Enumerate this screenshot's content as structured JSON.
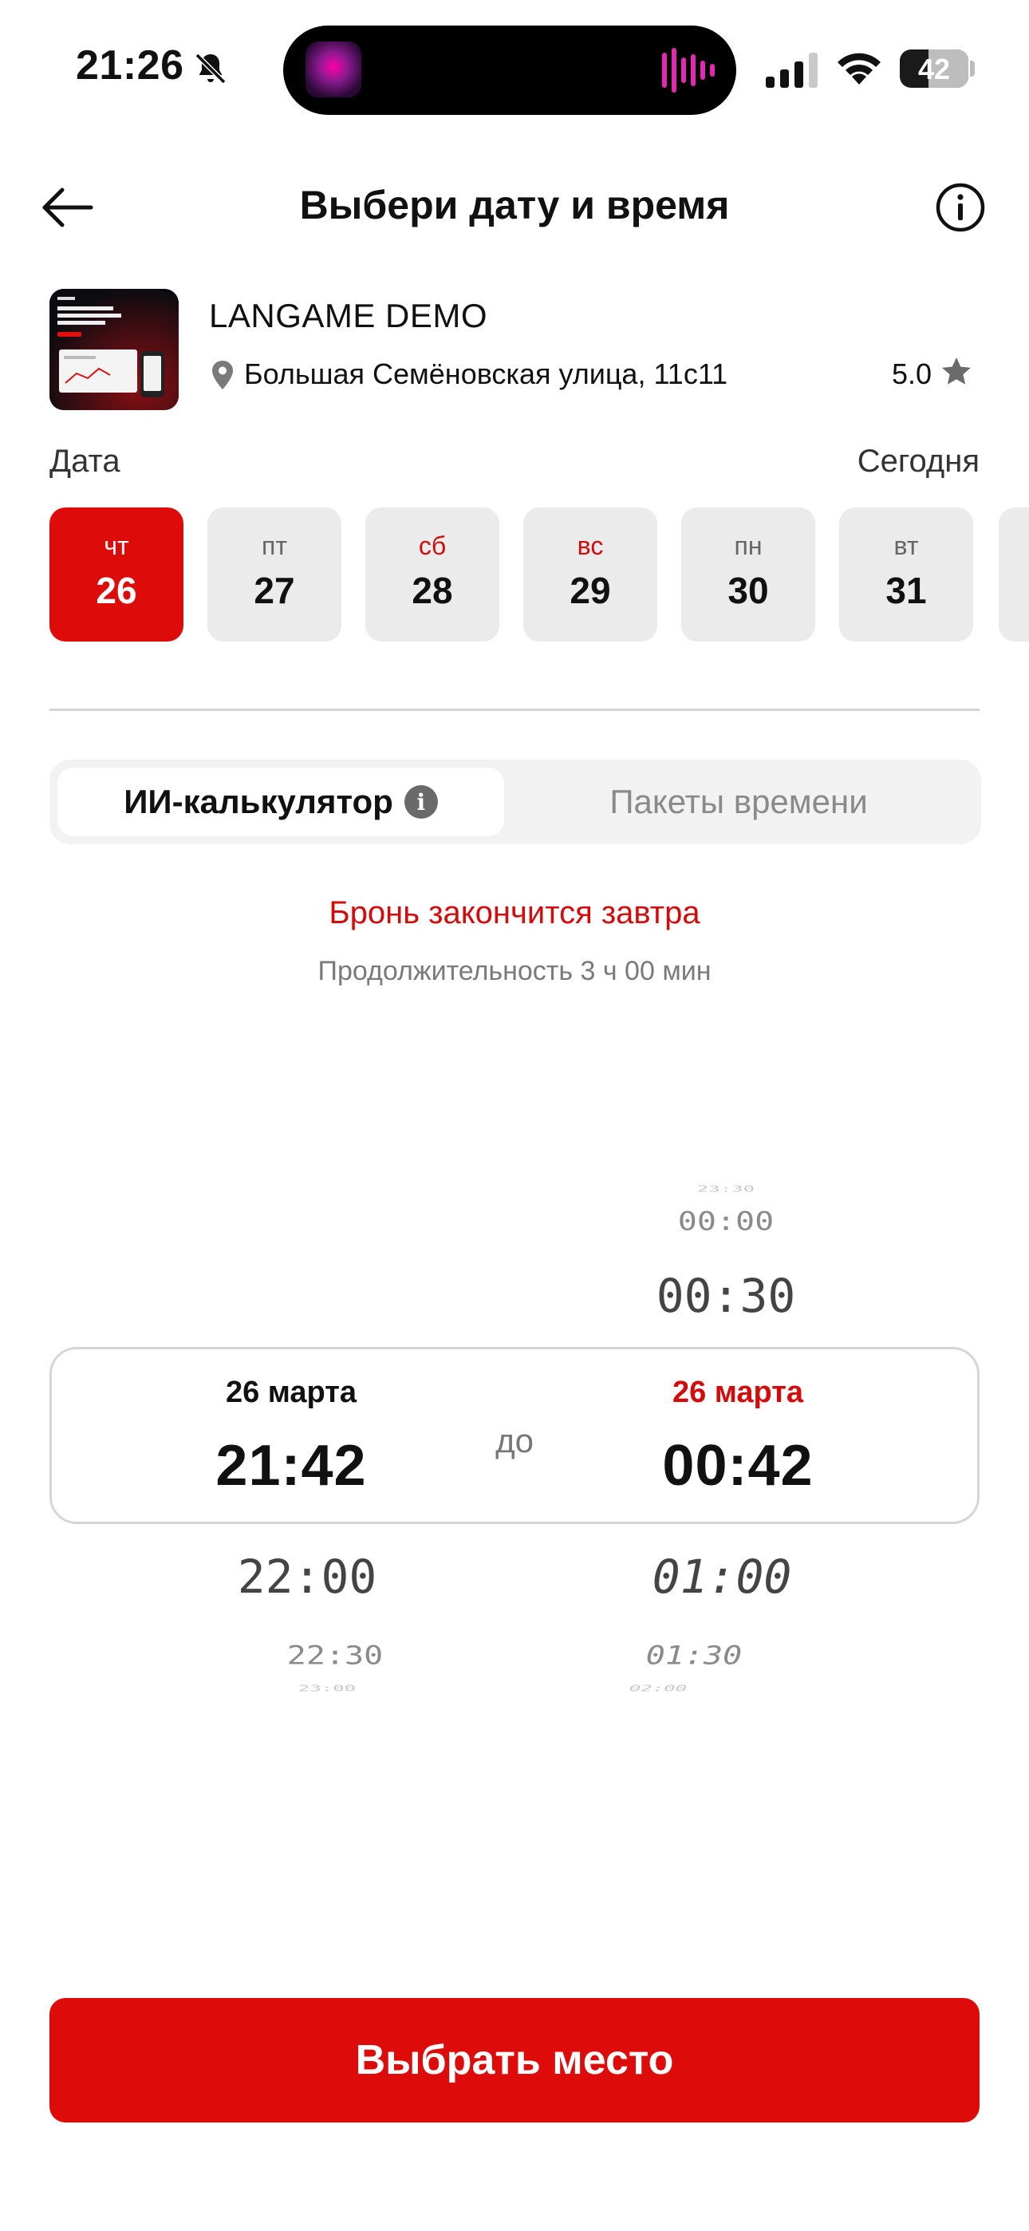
{
  "status_bar": {
    "time": "21:26",
    "battery": "42",
    "battery_level": 0.42
  },
  "header": {
    "title": "Выбери дату и время"
  },
  "club": {
    "name": "LANGAME DEMO",
    "address": "Большая Семёновская улица, 11с11",
    "rating": "5.0"
  },
  "date_section": {
    "label": "Дата",
    "today_label": "Сегодня",
    "days": [
      {
        "dow": "чт",
        "num": "26",
        "active": true,
        "weekend": false
      },
      {
        "dow": "пт",
        "num": "27",
        "active": false,
        "weekend": false
      },
      {
        "dow": "сб",
        "num": "28",
        "active": false,
        "weekend": true
      },
      {
        "dow": "вс",
        "num": "29",
        "active": false,
        "weekend": true
      },
      {
        "dow": "пн",
        "num": "30",
        "active": false,
        "weekend": false
      },
      {
        "dow": "вт",
        "num": "31",
        "active": false,
        "weekend": false
      }
    ]
  },
  "tabs": {
    "ai_calculator": "ИИ-калькулятор",
    "info_glyph": "i",
    "time_packages": "Пакеты времени"
  },
  "booking": {
    "end_message": "Бронь закончится завтра",
    "duration": "Продолжительность 3 ч 00 мин"
  },
  "picker": {
    "start": {
      "date": "26 марта",
      "time": "21:42",
      "below": [
        "22:00",
        "22:30",
        "23:00"
      ]
    },
    "separator": "до",
    "end": {
      "above": [
        "23:30",
        "00:00",
        "00:30"
      ],
      "date": "26 марта",
      "time": "00:42",
      "below": [
        "01:00",
        "01:30",
        "02:00"
      ]
    }
  },
  "actions": {
    "choose_place": "Выбрать место"
  },
  "colors": {
    "accent": "#DE0B0B",
    "muted": "#EBEBEB"
  }
}
